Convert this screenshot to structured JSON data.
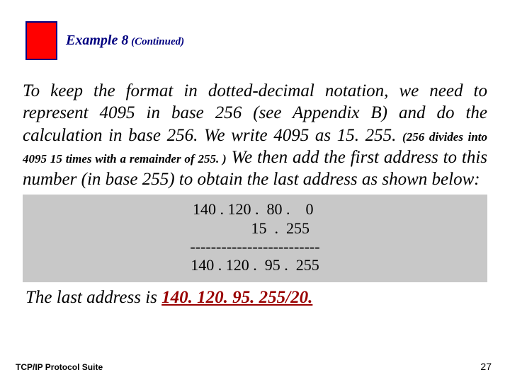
{
  "header": {
    "example_label": "Example 8",
    "continued": " (Continued)"
  },
  "body": {
    "part1": "To keep the format in dotted-decimal notation, we need to represent 4095 in base 256 (see Appendix B) and do the calculation in base 256. We write 4095 as 15. 255. ",
    "inline_note": "(256 divides into 4095 15 times with a remainder of 255. )",
    "part2": " We then add the first address to this number (in base 255) to obtain the last address as shown below:"
  },
  "calc": {
    "line1": "140 . 120 .  80 .    0 ",
    "line2": "             15  .  255",
    "line3": "-------------------------",
    "line4": "140 . 120 .  95 .  255"
  },
  "final": {
    "prefix": "The last address is ",
    "answer": "140. 120. 95. 255/20.",
    "suffix": ""
  },
  "footer": {
    "left": "TCP/IP Protocol Suite",
    "page": "27"
  }
}
